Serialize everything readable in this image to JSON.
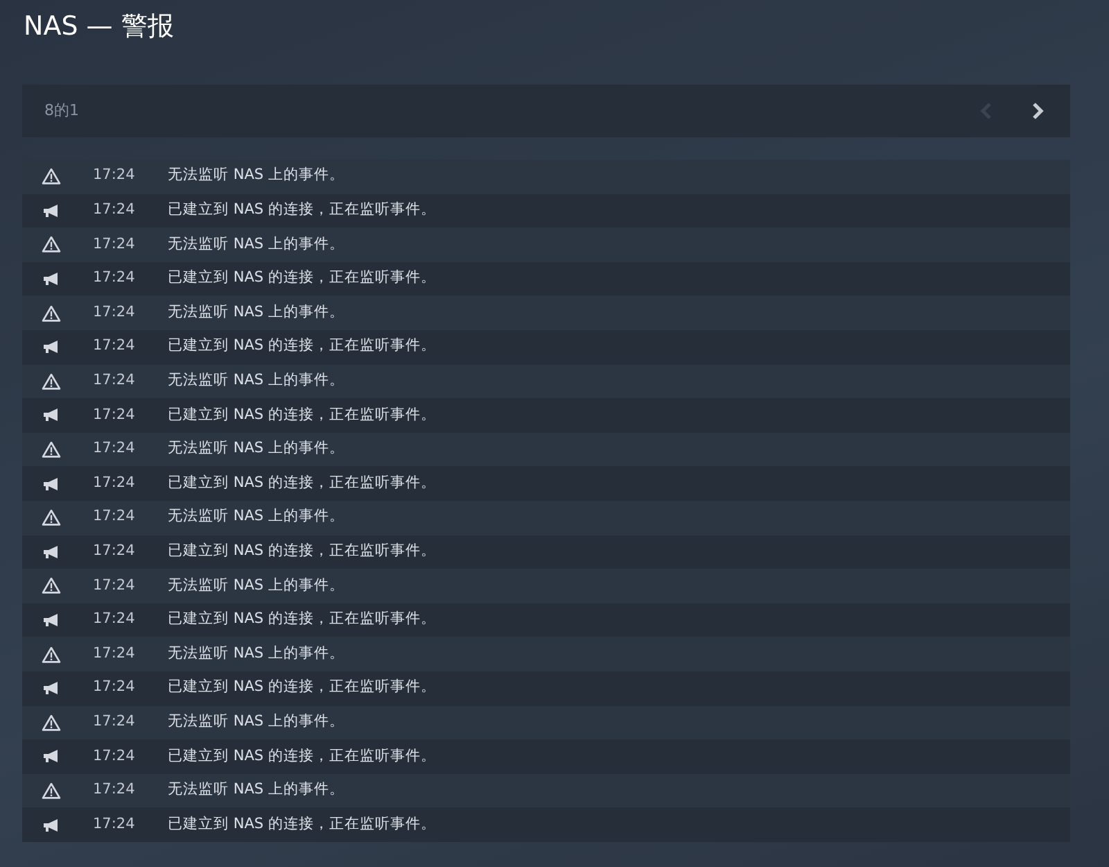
{
  "title": "NAS — 警报",
  "pager": {
    "text": "8的1",
    "prev": {
      "disabled": true
    },
    "next": {
      "disabled": false
    }
  },
  "alerts": [
    {
      "kind": "warning",
      "time": "17:24",
      "message": "无法监听 NAS 上的事件。"
    },
    {
      "kind": "info",
      "time": "17:24",
      "message": "已建立到 NAS 的连接，正在监听事件。"
    },
    {
      "kind": "warning",
      "time": "17:24",
      "message": "无法监听 NAS 上的事件。"
    },
    {
      "kind": "info",
      "time": "17:24",
      "message": "已建立到 NAS 的连接，正在监听事件。"
    },
    {
      "kind": "warning",
      "time": "17:24",
      "message": "无法监听 NAS 上的事件。"
    },
    {
      "kind": "info",
      "time": "17:24",
      "message": "已建立到 NAS 的连接，正在监听事件。"
    },
    {
      "kind": "warning",
      "time": "17:24",
      "message": "无法监听 NAS 上的事件。"
    },
    {
      "kind": "info",
      "time": "17:24",
      "message": "已建立到 NAS 的连接，正在监听事件。"
    },
    {
      "kind": "warning",
      "time": "17:24",
      "message": "无法监听 NAS 上的事件。"
    },
    {
      "kind": "info",
      "time": "17:24",
      "message": "已建立到 NAS 的连接，正在监听事件。"
    },
    {
      "kind": "warning",
      "time": "17:24",
      "message": "无法监听 NAS 上的事件。"
    },
    {
      "kind": "info",
      "time": "17:24",
      "message": "已建立到 NAS 的连接，正在监听事件。"
    },
    {
      "kind": "warning",
      "time": "17:24",
      "message": "无法监听 NAS 上的事件。"
    },
    {
      "kind": "info",
      "time": "17:24",
      "message": "已建立到 NAS 的连接，正在监听事件。"
    },
    {
      "kind": "warning",
      "time": "17:24",
      "message": "无法监听 NAS 上的事件。"
    },
    {
      "kind": "info",
      "time": "17:24",
      "message": "已建立到 NAS 的连接，正在监听事件。"
    },
    {
      "kind": "warning",
      "time": "17:24",
      "message": "无法监听 NAS 上的事件。"
    },
    {
      "kind": "info",
      "time": "17:24",
      "message": "已建立到 NAS 的连接，正在监听事件。"
    },
    {
      "kind": "warning",
      "time": "17:24",
      "message": "无法监听 NAS 上的事件。"
    },
    {
      "kind": "info",
      "time": "17:24",
      "message": "已建立到 NAS 的连接，正在监听事件。"
    }
  ]
}
